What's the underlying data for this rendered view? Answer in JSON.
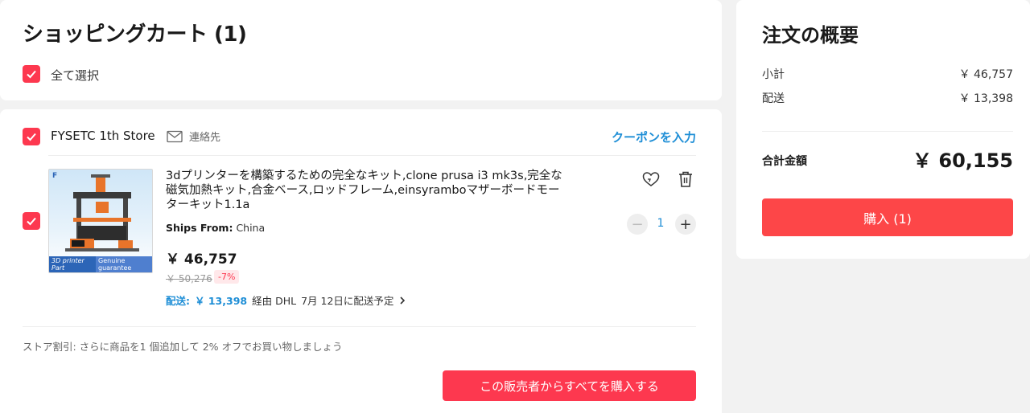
{
  "cart": {
    "title": "ショッピングカート (1)",
    "select_all_label": "全て選択"
  },
  "store": {
    "name": "FYSETC 1th Store",
    "contact_label": "連絡先",
    "coupon_label": "クーポンを入力",
    "store_discount_text": "ストア割引: さらに商品を1 個追加して 2% オフでお買い物しましょう",
    "buy_all_label": "この販売者からすべてを購入する"
  },
  "item": {
    "title": "3dプリンターを構築するための完全なキット,clone prusa i3 mk3s,完全な磁気加熱キット,合金ベース,ロッドフレーム,einsyramboマザーボードモーターキット1.1a",
    "ships_from_label": "Ships From:",
    "ships_from_value": "China",
    "price": "￥ 46,757",
    "original_price": "￥ 50,276",
    "discount": "-7%",
    "shipping_label": "配送:",
    "shipping_cost": "￥ 13,398",
    "shipping_method": "経由 DHL",
    "delivery_date": "7月 12日に配送予定",
    "quantity": "1",
    "thumb_banner_left": "3D printer Part",
    "thumb_banner_right": "Genuine guarantee",
    "thumb_logo": "F"
  },
  "summary": {
    "title": "注文の概要",
    "subtotal_label": "小計",
    "subtotal_value": "￥ 46,757",
    "shipping_label": "配送",
    "shipping_value": "￥ 13,398",
    "total_label": "合計金額",
    "total_value": "￥ 60,155",
    "buy_label": "購入 (1)"
  },
  "colors": {
    "accent_red": "#fd384f",
    "link_blue": "#1e8ed6"
  },
  "icons": [
    "check-icon",
    "mail-icon",
    "wishlist-heart-icon",
    "trash-icon",
    "chevron-right-icon"
  ]
}
